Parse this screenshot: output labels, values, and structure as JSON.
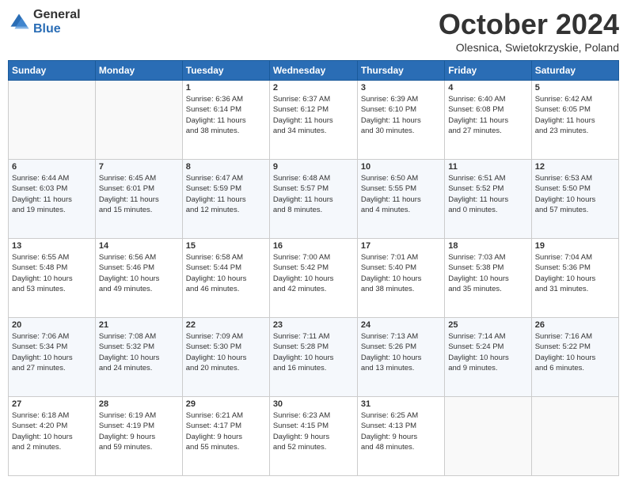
{
  "logo": {
    "general": "General",
    "blue": "Blue"
  },
  "header": {
    "title": "October 2024",
    "subtitle": "Olesnica, Swietokrzyskie, Poland"
  },
  "calendar": {
    "headers": [
      "Sunday",
      "Monday",
      "Tuesday",
      "Wednesday",
      "Thursday",
      "Friday",
      "Saturday"
    ],
    "weeks": [
      [
        {
          "day": "",
          "info": ""
        },
        {
          "day": "",
          "info": ""
        },
        {
          "day": "1",
          "info": "Sunrise: 6:36 AM\nSunset: 6:14 PM\nDaylight: 11 hours\nand 38 minutes."
        },
        {
          "day": "2",
          "info": "Sunrise: 6:37 AM\nSunset: 6:12 PM\nDaylight: 11 hours\nand 34 minutes."
        },
        {
          "day": "3",
          "info": "Sunrise: 6:39 AM\nSunset: 6:10 PM\nDaylight: 11 hours\nand 30 minutes."
        },
        {
          "day": "4",
          "info": "Sunrise: 6:40 AM\nSunset: 6:08 PM\nDaylight: 11 hours\nand 27 minutes."
        },
        {
          "day": "5",
          "info": "Sunrise: 6:42 AM\nSunset: 6:05 PM\nDaylight: 11 hours\nand 23 minutes."
        }
      ],
      [
        {
          "day": "6",
          "info": "Sunrise: 6:44 AM\nSunset: 6:03 PM\nDaylight: 11 hours\nand 19 minutes."
        },
        {
          "day": "7",
          "info": "Sunrise: 6:45 AM\nSunset: 6:01 PM\nDaylight: 11 hours\nand 15 minutes."
        },
        {
          "day": "8",
          "info": "Sunrise: 6:47 AM\nSunset: 5:59 PM\nDaylight: 11 hours\nand 12 minutes."
        },
        {
          "day": "9",
          "info": "Sunrise: 6:48 AM\nSunset: 5:57 PM\nDaylight: 11 hours\nand 8 minutes."
        },
        {
          "day": "10",
          "info": "Sunrise: 6:50 AM\nSunset: 5:55 PM\nDaylight: 11 hours\nand 4 minutes."
        },
        {
          "day": "11",
          "info": "Sunrise: 6:51 AM\nSunset: 5:52 PM\nDaylight: 11 hours\nand 0 minutes."
        },
        {
          "day": "12",
          "info": "Sunrise: 6:53 AM\nSunset: 5:50 PM\nDaylight: 10 hours\nand 57 minutes."
        }
      ],
      [
        {
          "day": "13",
          "info": "Sunrise: 6:55 AM\nSunset: 5:48 PM\nDaylight: 10 hours\nand 53 minutes."
        },
        {
          "day": "14",
          "info": "Sunrise: 6:56 AM\nSunset: 5:46 PM\nDaylight: 10 hours\nand 49 minutes."
        },
        {
          "day": "15",
          "info": "Sunrise: 6:58 AM\nSunset: 5:44 PM\nDaylight: 10 hours\nand 46 minutes."
        },
        {
          "day": "16",
          "info": "Sunrise: 7:00 AM\nSunset: 5:42 PM\nDaylight: 10 hours\nand 42 minutes."
        },
        {
          "day": "17",
          "info": "Sunrise: 7:01 AM\nSunset: 5:40 PM\nDaylight: 10 hours\nand 38 minutes."
        },
        {
          "day": "18",
          "info": "Sunrise: 7:03 AM\nSunset: 5:38 PM\nDaylight: 10 hours\nand 35 minutes."
        },
        {
          "day": "19",
          "info": "Sunrise: 7:04 AM\nSunset: 5:36 PM\nDaylight: 10 hours\nand 31 minutes."
        }
      ],
      [
        {
          "day": "20",
          "info": "Sunrise: 7:06 AM\nSunset: 5:34 PM\nDaylight: 10 hours\nand 27 minutes."
        },
        {
          "day": "21",
          "info": "Sunrise: 7:08 AM\nSunset: 5:32 PM\nDaylight: 10 hours\nand 24 minutes."
        },
        {
          "day": "22",
          "info": "Sunrise: 7:09 AM\nSunset: 5:30 PM\nDaylight: 10 hours\nand 20 minutes."
        },
        {
          "day": "23",
          "info": "Sunrise: 7:11 AM\nSunset: 5:28 PM\nDaylight: 10 hours\nand 16 minutes."
        },
        {
          "day": "24",
          "info": "Sunrise: 7:13 AM\nSunset: 5:26 PM\nDaylight: 10 hours\nand 13 minutes."
        },
        {
          "day": "25",
          "info": "Sunrise: 7:14 AM\nSunset: 5:24 PM\nDaylight: 10 hours\nand 9 minutes."
        },
        {
          "day": "26",
          "info": "Sunrise: 7:16 AM\nSunset: 5:22 PM\nDaylight: 10 hours\nand 6 minutes."
        }
      ],
      [
        {
          "day": "27",
          "info": "Sunrise: 6:18 AM\nSunset: 4:20 PM\nDaylight: 10 hours\nand 2 minutes."
        },
        {
          "day": "28",
          "info": "Sunrise: 6:19 AM\nSunset: 4:19 PM\nDaylight: 9 hours\nand 59 minutes."
        },
        {
          "day": "29",
          "info": "Sunrise: 6:21 AM\nSunset: 4:17 PM\nDaylight: 9 hours\nand 55 minutes."
        },
        {
          "day": "30",
          "info": "Sunrise: 6:23 AM\nSunset: 4:15 PM\nDaylight: 9 hours\nand 52 minutes."
        },
        {
          "day": "31",
          "info": "Sunrise: 6:25 AM\nSunset: 4:13 PM\nDaylight: 9 hours\nand 48 minutes."
        },
        {
          "day": "",
          "info": ""
        },
        {
          "day": "",
          "info": ""
        }
      ]
    ]
  }
}
